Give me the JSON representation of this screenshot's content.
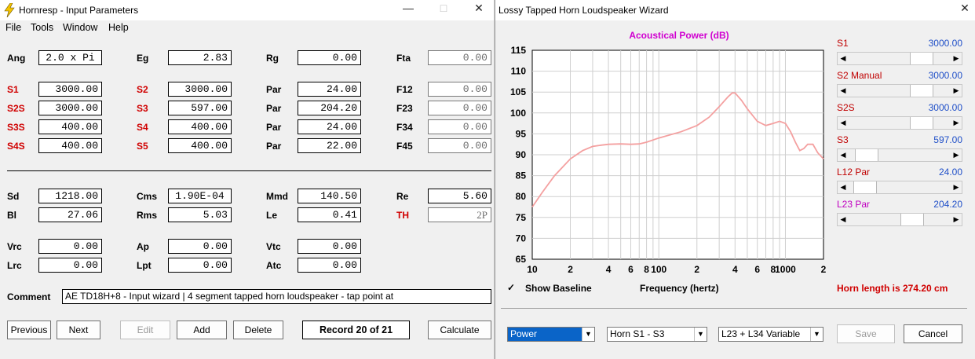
{
  "left_window": {
    "title": "Hornresp - Input Parameters",
    "menu": [
      "File",
      "Tools",
      "Window",
      "Help"
    ],
    "params": {
      "Ang": "2.0 x Pi",
      "Eg": "2.83",
      "Rg": "0.00",
      "Fta": "0.00",
      "S1": "3000.00",
      "S2": "3000.00",
      "Par1": "24.00",
      "F12": "0.00",
      "S2S": "3000.00",
      "S3": "597.00",
      "Par2": "204.20",
      "F23": "0.00",
      "S3S": "400.00",
      "S4": "400.00",
      "Par3": "24.00",
      "F34": "0.00",
      "S4S": "400.00",
      "S5": "400.00",
      "Par4": "22.00",
      "F45": "0.00",
      "Sd": "1218.00",
      "Cms": "1.90E-04",
      "Mmd": "140.50",
      "Re": "5.60",
      "Bl": "27.06",
      "Rms": "5.03",
      "Le": "0.41",
      "TH": "2P",
      "Vrc": "0.00",
      "Ap": "0.00",
      "Vtc": "0.00",
      "Lrc": "0.00",
      "Lpt": "0.00",
      "Atc": "0.00"
    },
    "labels": {
      "Ang": "Ang",
      "Eg": "Eg",
      "Rg": "Rg",
      "Fta": "Fta",
      "S1": "S1",
      "S2": "S2",
      "Par": "Par",
      "F12": "F12",
      "S2S": "S2S",
      "S3": "S3",
      "F23": "F23",
      "S3S": "S3S",
      "S4": "S4",
      "F34": "F34",
      "S4S": "S4S",
      "S5": "S5",
      "F45": "F45",
      "Sd": "Sd",
      "Cms": "Cms",
      "Mmd": "Mmd",
      "Re": "Re",
      "Bl": "Bl",
      "Rms": "Rms",
      "Le": "Le",
      "TH": "TH",
      "Vrc": "Vrc",
      "Ap": "Ap",
      "Vtc": "Vtc",
      "Lrc": "Lrc",
      "Lpt": "Lpt",
      "Atc": "Atc",
      "Comment": "Comment"
    },
    "comment": "AE TD18H+8 - Input wizard | 4 segment tapped horn loudspeaker - tap point at",
    "buttons": {
      "previous": "Previous",
      "next": "Next",
      "edit": "Edit",
      "add": "Add",
      "delete": "Delete",
      "calculate": "Calculate"
    },
    "record": "Record 20 of 21"
  },
  "right_window": {
    "title": "Lossy Tapped Horn Loudspeaker Wizard",
    "chart_title": "Acoustical Power (dB)",
    "xlabel": "Frequency (hertz)",
    "show_baseline": "Show Baseline",
    "horn_length": "Horn length is 274.20 cm",
    "sliders": [
      {
        "label": "S1",
        "value": "3000.00",
        "color": "#c00000",
        "fraction": 0.78
      },
      {
        "label": "S2  Manual",
        "value": "3000.00",
        "color": "#c00000",
        "fraction": 0.78
      },
      {
        "label": "S2S",
        "value": "3000.00",
        "color": "#c00000",
        "fraction": 0.78
      },
      {
        "label": "S3",
        "value": "597.00",
        "color": "#c00000",
        "fraction": 0.08
      },
      {
        "label": "L12  Par",
        "value": "24.00",
        "color": "#c00000",
        "fraction": 0.06
      },
      {
        "label": "L23  Par",
        "value": "204.20",
        "color": "#c000c0",
        "fraction": 0.66
      }
    ],
    "combos": {
      "mode": "Power",
      "horn": "Horn S1 - S3",
      "variable": "L23 + L34 Variable"
    },
    "buttons": {
      "save": "Save",
      "cancel": "Cancel"
    }
  },
  "chart_data": {
    "type": "line",
    "title": "Acoustical Power (dB)",
    "xlabel": "Frequency (hertz)",
    "ylabel": "",
    "x_scale": "log",
    "xlim": [
      10,
      2000
    ],
    "ylim": [
      65,
      115
    ],
    "yticks": [
      65,
      70,
      75,
      80,
      85,
      90,
      95,
      100,
      105,
      110,
      115
    ],
    "xtick_labels": [
      [
        "10",
        10
      ],
      [
        "2",
        20
      ],
      [
        "4",
        40
      ],
      [
        "6",
        60
      ],
      [
        "8",
        80
      ],
      [
        "100",
        100
      ],
      [
        "2",
        200
      ],
      [
        "4",
        400
      ],
      [
        "6",
        600
      ],
      [
        "8",
        800
      ],
      [
        "1000",
        1000
      ],
      [
        "2",
        2000
      ]
    ],
    "series": [
      {
        "color": "#f4a0a0",
        "x": [
          10,
          12,
          15,
          20,
          25,
          30,
          35,
          40,
          50,
          60,
          70,
          80,
          100,
          150,
          200,
          250,
          300,
          350,
          380,
          400,
          450,
          500,
          600,
          700,
          800,
          900,
          1000,
          1100,
          1200,
          1300,
          1400,
          1500,
          1650,
          1800,
          2000
        ],
        "values": [
          77.5,
          81,
          85,
          89,
          91,
          92,
          92.3,
          92.5,
          92.6,
          92.5,
          92.6,
          93,
          94,
          95.5,
          97,
          99,
          101.5,
          103.8,
          104.8,
          104.8,
          103,
          101,
          98,
          97,
          97.5,
          98,
          97.5,
          95.5,
          93,
          91,
          91.5,
          92.5,
          92.5,
          90.5,
          89
        ]
      }
    ]
  }
}
